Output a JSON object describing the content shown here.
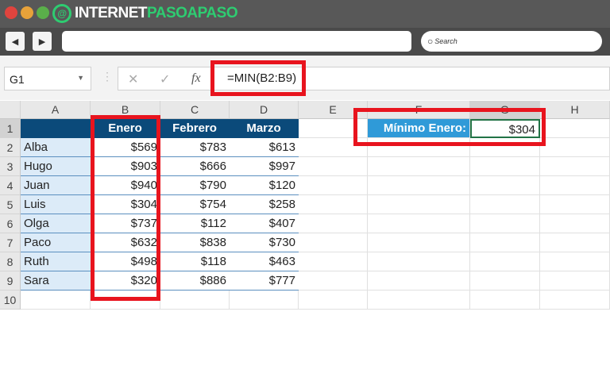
{
  "brand": {
    "logo_prefix": "INTERNET",
    "logo_suffix": "PASOAPASO",
    "accent": "#2ecc71"
  },
  "browser": {
    "back_icon": "arrow-left-icon",
    "forward_icon": "arrow-right-icon",
    "search_placeholder": "Search"
  },
  "formula_bar": {
    "name_box": "G1",
    "formula": "=MIN(B2:B9)",
    "fx_label": "fx"
  },
  "columns": [
    "A",
    "B",
    "C",
    "D",
    "E",
    "F",
    "G",
    "H"
  ],
  "rows": [
    "1",
    "2",
    "3",
    "4",
    "5",
    "6",
    "7",
    "8",
    "9",
    "10"
  ],
  "table": {
    "headers": [
      "",
      "Enero",
      "Febrero",
      "Marzo"
    ],
    "data": [
      [
        "Alba",
        "$569",
        "$783",
        "$613"
      ],
      [
        "Hugo",
        "$903",
        "$666",
        "$997"
      ],
      [
        "Juan",
        "$940",
        "$790",
        "$120"
      ],
      [
        "Luis",
        "$304",
        "$754",
        "$258"
      ],
      [
        "Olga",
        "$737",
        "$112",
        "$407"
      ],
      [
        "Paco",
        "$632",
        "$838",
        "$730"
      ],
      [
        "Ruth",
        "$498",
        "$118",
        "$463"
      ],
      [
        "Sara",
        "$320",
        "$886",
        "$777"
      ]
    ]
  },
  "result": {
    "label": "Mínimo Enero:",
    "value": "$304"
  },
  "colors": {
    "header_fill": "#0b4a7a",
    "name_fill": "#dcebf8",
    "label_fill": "#2f9ad8",
    "highlight": "#e8141e",
    "selection": "#217346"
  }
}
